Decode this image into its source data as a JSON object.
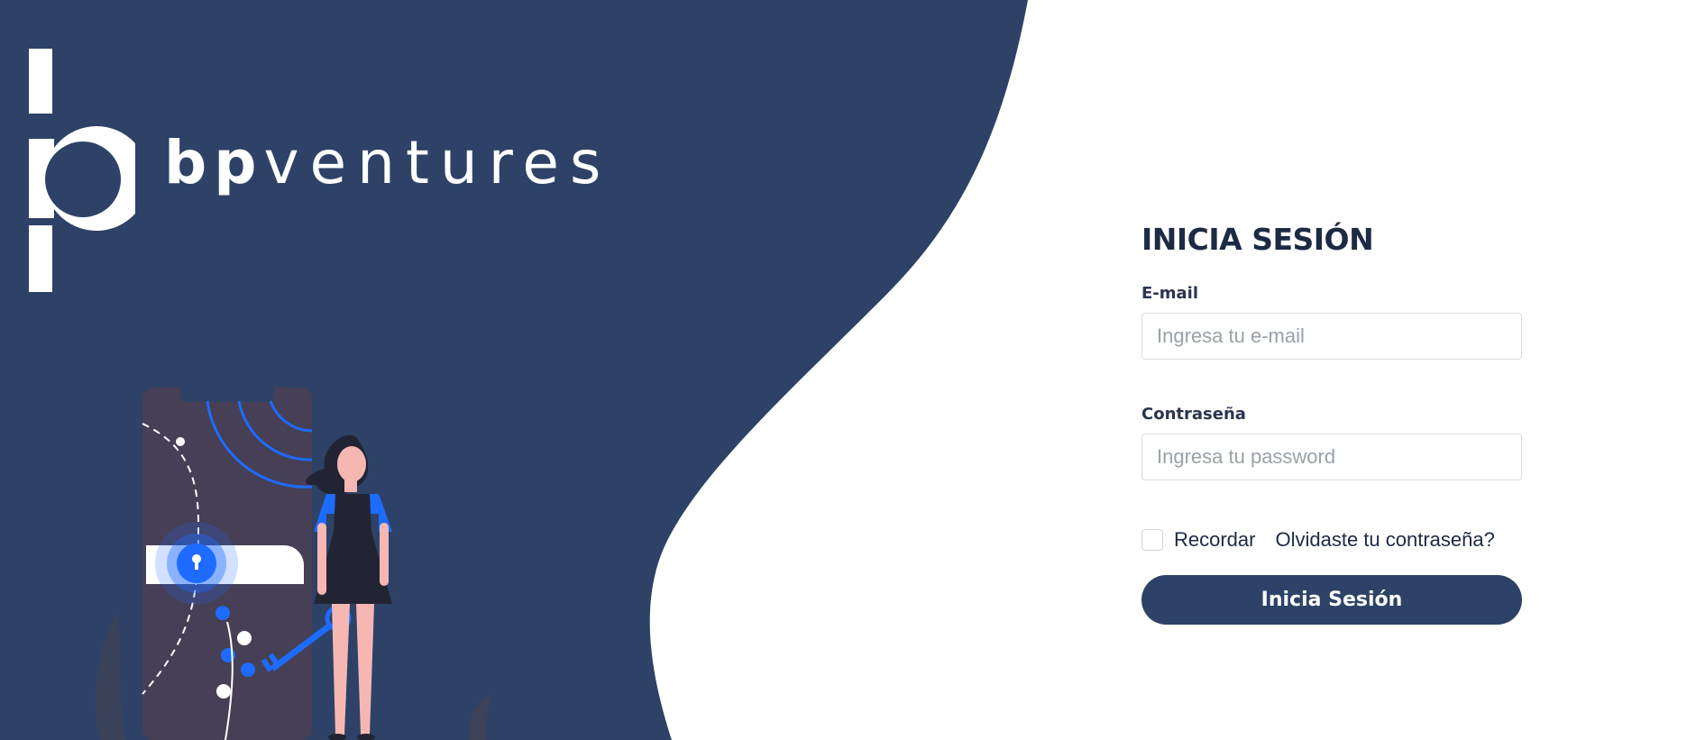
{
  "brand": {
    "name_bold": "bp",
    "name_light": "ventures"
  },
  "login": {
    "title": "INICIA SESIÓN",
    "email_label": "E-mail",
    "email_placeholder": "Ingresa tu e-mail",
    "email_value": "",
    "password_label": "Contraseña",
    "password_placeholder": "Ingresa tu password",
    "password_value": "",
    "remember_label": "Recordar",
    "remember_checked": false,
    "forgot_label": "Olvidaste tu contraseña?",
    "submit_label": "Inicia Sesión"
  },
  "colors": {
    "brand_navy": "#2d4266",
    "accent_blue": "#1e6bff",
    "text_dark": "#1d2a44"
  },
  "icons": {
    "illustration": "person-with-key-and-phone-lock-illustration"
  }
}
